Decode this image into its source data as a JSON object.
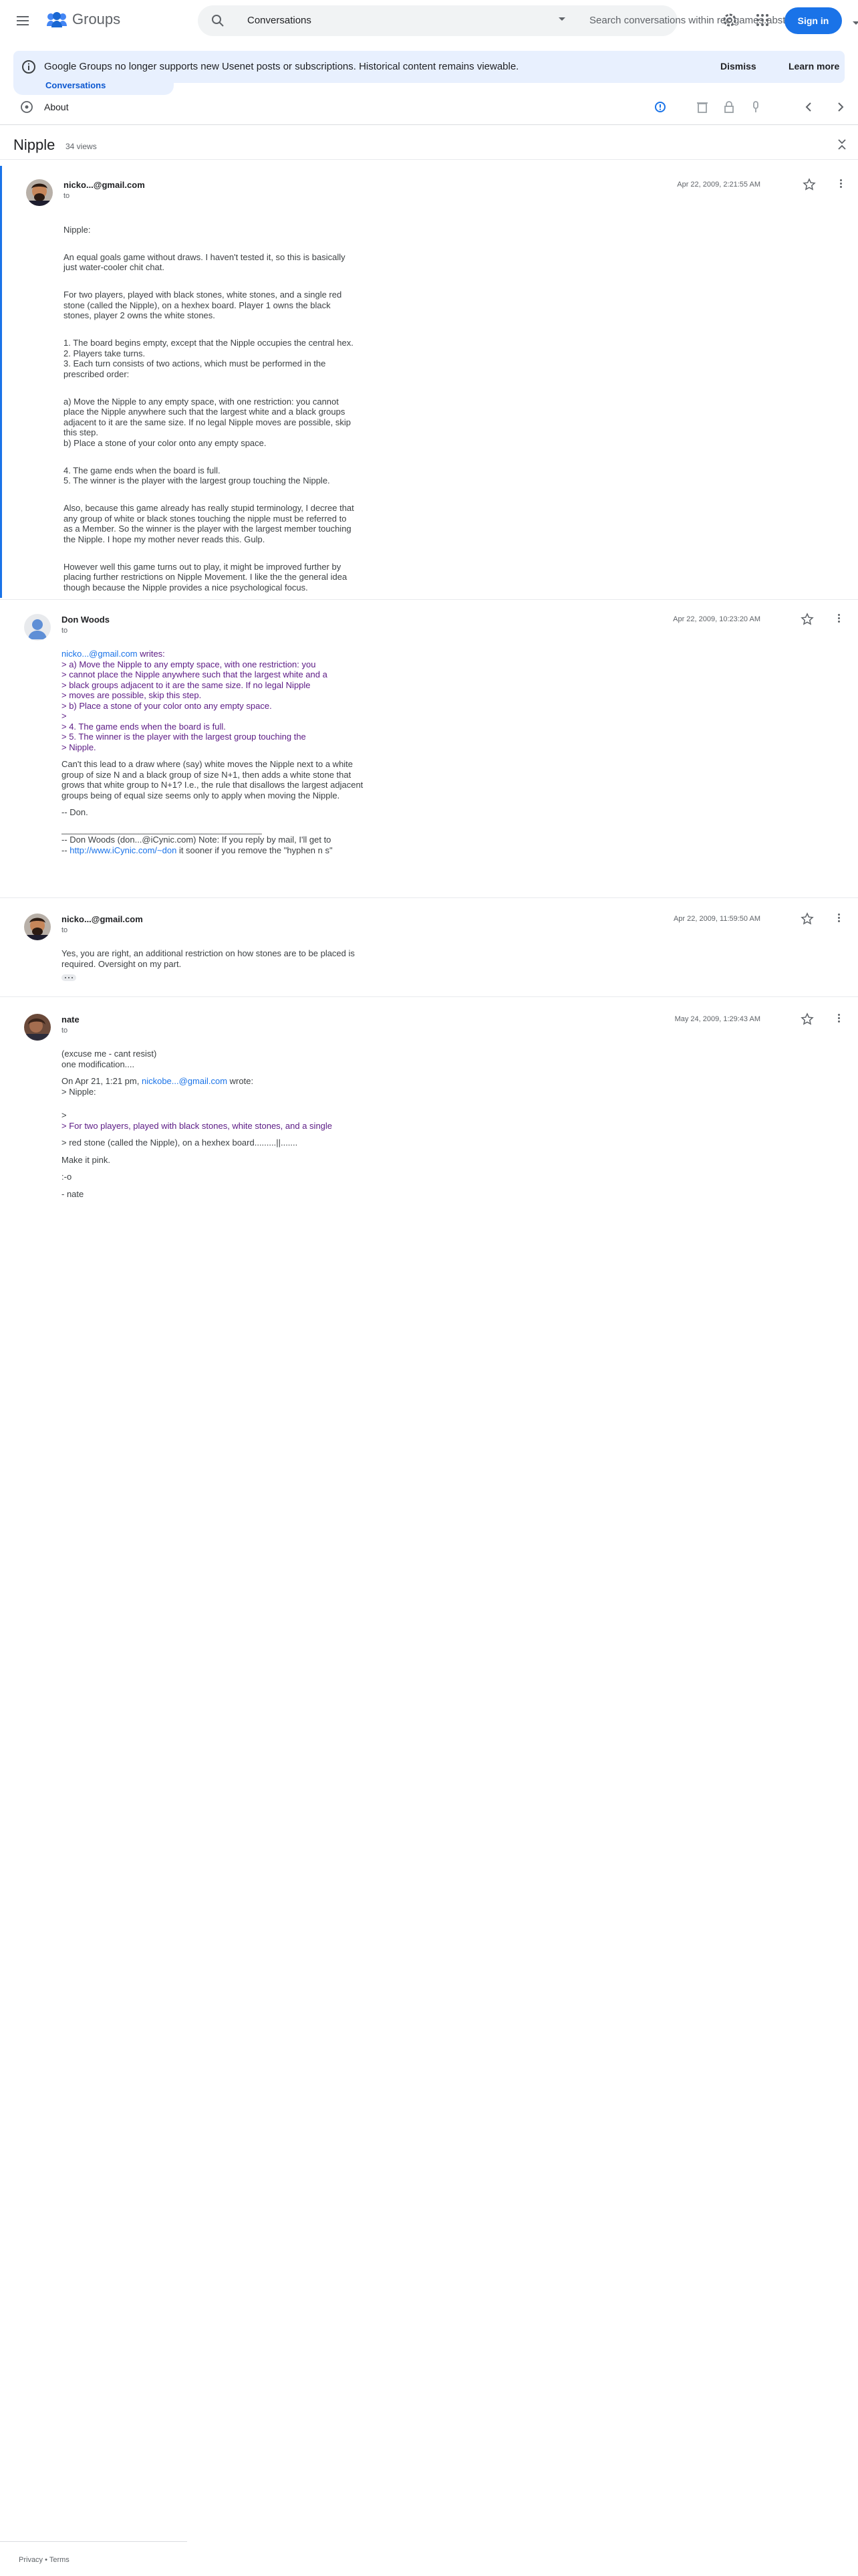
{
  "header": {
    "app_name": "Groups",
    "search_scope": "Conversations",
    "search_placeholder": "Search conversations within rec.games.abstr...",
    "signin": "Sign in"
  },
  "banner": {
    "text": "Google Groups no longer supports new Usenet posts or subscriptions. Historical content remains viewable.",
    "dismiss": "Dismiss",
    "learn_more": "Learn more"
  },
  "nav": {
    "conversations": "Conversations",
    "about": "About"
  },
  "thread": {
    "title": "Nipple",
    "views": "34 views"
  },
  "messages": [
    {
      "author": "nicko...@gmail.com",
      "to": "to",
      "date": "Apr 22, 2009, 2:21:55 AM",
      "paras": [
        "Nipple:",
        "An equal goals game without draws. I haven't tested it, so this is basically just water-cooler chit chat.",
        "For two players, played with black stones, white stones, and a single red stone (called the Nipple), on a hexhex board. Player 1 owns the black stones, player 2 owns the white stones.",
        "1. The board begins empty, except that the Nipple occupies the central hex.\n2. Players take turns.\n3. Each turn consists of two actions, which must be performed in the prescribed order:",
        "a) Move the Nipple to any empty space, with one restriction: you cannot place the Nipple anywhere such that the largest white and a black groups adjacent to it are the same size. If no legal Nipple moves are possible, skip this step.\nb) Place a stone of your color onto any empty space.",
        "4. The game ends when the board is full.\n5. The winner is the player with the largest group touching the Nipple.",
        "Also, because this game already has really stupid terminology, I decree that any group of white or black stones touching the nipple must be referred to as a Member. So the winner is the player with the largest member touching the Nipple. I hope my mother never reads this. Gulp.",
        "However well this game turns out to play, it might be improved further by placing further restrictions on Nipple Movement. I like the the general idea though because the Nipple provides a nice psychological focus."
      ]
    },
    {
      "author": "Don Woods",
      "to": "to",
      "date": "Apr 22, 2009, 10:23:20 AM",
      "attrib_link": "nicko...@gmail.com",
      "attrib_rest": " writes:",
      "quote": "> a) Move the Nipple to any empty space, with one restriction: you\n> cannot place the Nipple anywhere such that the largest white and a\n> black groups adjacent to it are the same size. If no legal Nipple\n> moves are possible, skip this step.\n> b) Place a stone of your color onto any empty space.\n>\n> 4. The game ends when the board is full.\n> 5. The winner is the player with the largest group touching the\n> Nipple.",
      "text": "Can't this lead to a draw where (say) white moves the Nipple next to a white group of size N and a black group of size N+1, then adds a white stone that grows that white group to N+1? I.e., the rule that disallows the largest adjacent groups being of equal size seems only to apply when moving the Nipple.",
      "sign": "-- Don.",
      "rule": "____________________________________________________________________",
      "sig1": "-- Don Woods (don...@iCynic.com) Note: If you reply by mail, I'll get to",
      "sig2_pre": "-- ",
      "sig2_link": "http://www.iCynic.com/~don",
      "sig2_post": " it sooner if you remove the \"hyphen n s\""
    },
    {
      "author": "nicko...@gmail.com",
      "to": "to",
      "date": "Apr 22, 2009, 11:59:50 AM",
      "text": "Yes, you are right, an additional restriction on how stones are to be placed is required. Oversight on my part."
    },
    {
      "author": "nate",
      "to": "to",
      "date": "May 24, 2009, 1:29:43 AM",
      "p1": "(excuse me - cant resist)\none modification....",
      "attrib_pre": "On Apr 21, 1:21 pm, ",
      "attrib_link": "nickobe...@gmail.com",
      "attrib_rest": " wrote:",
      "q1": "> Nipple:",
      "q2": ">",
      "q3": "> For two players, played with black stones, white stones, and a single",
      "q4": "> red stone (called the Nipple), on a hexhex board.........||.......",
      "p2": "Make it pink.",
      "p3": ":-o",
      "p4": "- nate"
    }
  ],
  "footer": {
    "privacy": "Privacy",
    "sep": " • ",
    "terms": "Terms"
  },
  "colors": {
    "accent": "#1a73e8",
    "banner_bg": "#e8f0fe",
    "quote": "#5b1a84"
  }
}
